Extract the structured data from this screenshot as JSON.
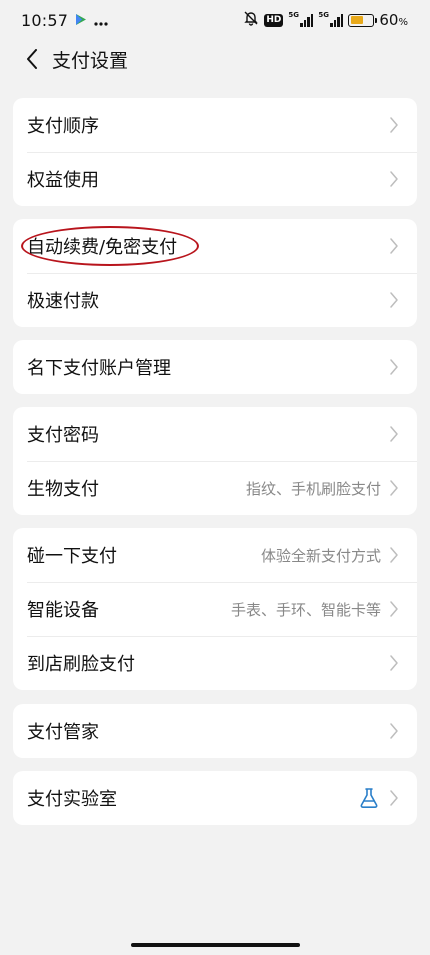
{
  "status_bar": {
    "time": "10:57",
    "icons": [
      "play-store-icon",
      "more-dots-icon",
      "bell-muted-icon",
      "hd-icon",
      "signal-5g-icon",
      "signal-5g-icon",
      "battery-icon"
    ],
    "hd_label": "HD",
    "network_label": "5G",
    "battery_percent": "60",
    "battery_unit": "%",
    "battery_level": 0.6,
    "battery_color": "#e8a91a"
  },
  "header": {
    "title": "支付设置"
  },
  "groups": [
    {
      "items": [
        {
          "label": "支付顺序",
          "sub": ""
        },
        {
          "label": "权益使用",
          "sub": ""
        }
      ]
    },
    {
      "items": [
        {
          "label": "自动续费/免密支付",
          "sub": "",
          "highlighted": true
        },
        {
          "label": "极速付款",
          "sub": ""
        }
      ]
    },
    {
      "items": [
        {
          "label": "名下支付账户管理",
          "sub": ""
        }
      ]
    },
    {
      "items": [
        {
          "label": "支付密码",
          "sub": ""
        },
        {
          "label": "生物支付",
          "sub": "指纹、手机刷脸支付"
        }
      ]
    },
    {
      "items": [
        {
          "label": "碰一下支付",
          "sub": "体验全新支付方式"
        },
        {
          "label": "智能设备",
          "sub": "手表、手环、智能卡等"
        },
        {
          "label": "到店刷脸支付",
          "sub": ""
        }
      ]
    },
    {
      "items": [
        {
          "label": "支付管家",
          "sub": ""
        }
      ]
    },
    {
      "items": [
        {
          "label": "支付实验室",
          "sub": "",
          "icon": "flask-icon"
        }
      ]
    }
  ],
  "colors": {
    "background": "#f2f2f2",
    "card": "#ffffff",
    "highlight_circle": "#b8141c",
    "flask_icon": "#2a7fc9"
  }
}
